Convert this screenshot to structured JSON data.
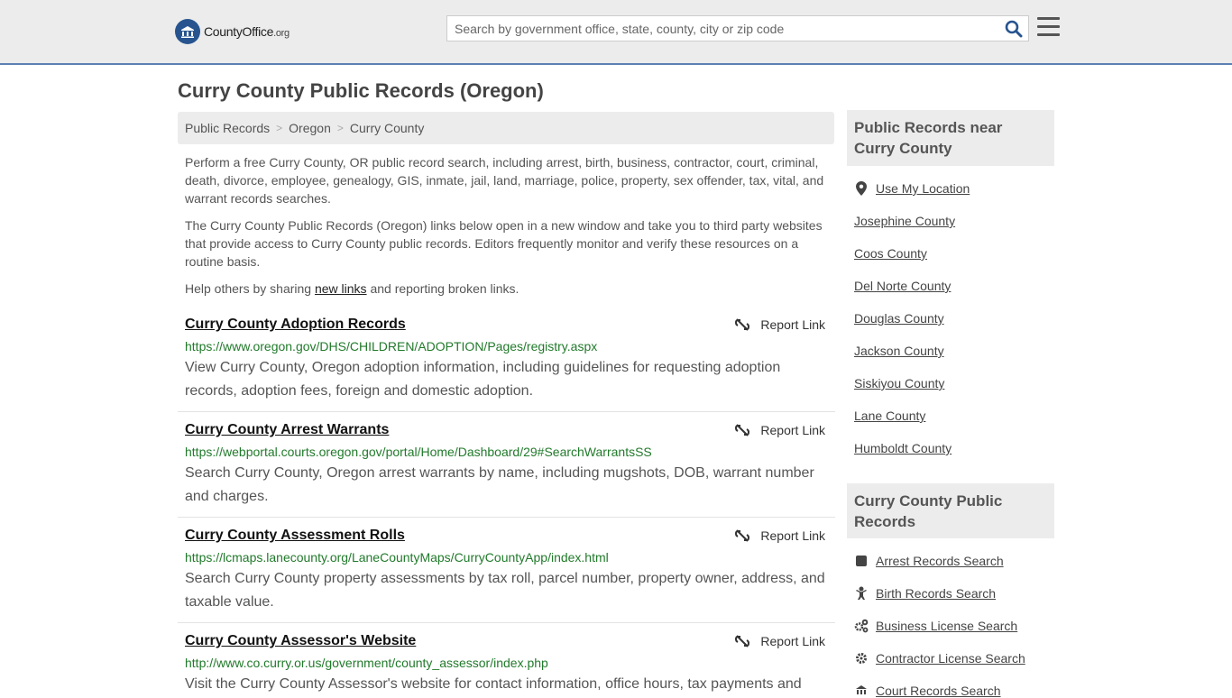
{
  "header": {
    "logo_text": "CountyOffice",
    "logo_tld": ".org",
    "search_placeholder": "Search by government office, state, county, city or zip code"
  },
  "page_title": "Curry County Public Records (Oregon)",
  "breadcrumb": [
    "Public Records",
    "Oregon",
    "Curry County"
  ],
  "intro": {
    "p1": "Perform a free Curry County, OR public record search, including arrest, birth, business, contractor, court, criminal, death, divorce, employee, genealogy, GIS, inmate, jail, land, marriage, police, property, sex offender, tax, vital, and warrant records searches.",
    "p2": "The Curry County Public Records (Oregon) links below open in a new window and take you to third party websites that provide access to Curry County public records. Editors frequently monitor and verify these resources on a routine basis.",
    "p3_before": "Help others by sharing ",
    "p3_link": "new links",
    "p3_after": " and reporting broken links."
  },
  "report_label": "Report Link",
  "records": [
    {
      "title": "Curry County Adoption Records",
      "url": "https://www.oregon.gov/DHS/CHILDREN/ADOPTION/Pages/registry.aspx",
      "desc": "View Curry County, Oregon adoption information, including guidelines for requesting adoption records, adoption fees, foreign and domestic adoption."
    },
    {
      "title": "Curry County Arrest Warrants",
      "url": "https://webportal.courts.oregon.gov/portal/Home/Dashboard/29#SearchWarrantsSS",
      "desc": "Search Curry County, Oregon arrest warrants by name, including mugshots, DOB, warrant number and charges."
    },
    {
      "title": "Curry County Assessment Rolls",
      "url": "https://lcmaps.lanecounty.org/LaneCountyMaps/CurryCountyApp/index.html",
      "desc": "Search Curry County property assessments by tax roll, parcel number, property owner, address, and taxable value."
    },
    {
      "title": "Curry County Assessor's Website",
      "url": "http://www.co.curry.or.us/government/county_assessor/index.php",
      "desc": "Visit the Curry County Assessor's website for contact information, office hours, tax payments and"
    }
  ],
  "sidebar": {
    "nearby_heading": "Public Records near Curry County",
    "use_location": "Use My Location",
    "nearby": [
      "Josephine County",
      "Coos County",
      "Del Norte County",
      "Douglas County",
      "Jackson County",
      "Siskiyou County",
      "Lane County",
      "Humboldt County"
    ],
    "records_heading": "Curry County Public Records",
    "record_links": [
      "Arrest Records Search",
      "Birth Records Search",
      "Business License Search",
      "Contractor License Search",
      "Court Records Search"
    ]
  }
}
